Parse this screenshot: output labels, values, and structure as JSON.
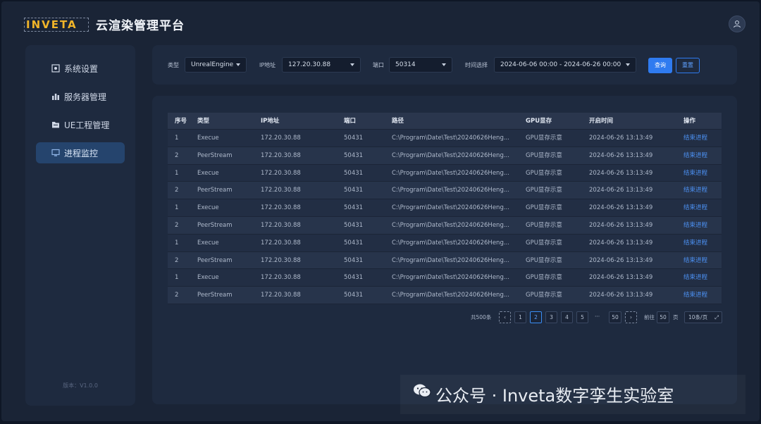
{
  "header": {
    "logo_text": "INVETA",
    "title": "云渲染管理平台"
  },
  "sidebar": {
    "items": [
      {
        "label": "系统设置",
        "icon": "gear-icon"
      },
      {
        "label": "服务器管理",
        "icon": "server-icon"
      },
      {
        "label": "UE工程管理",
        "icon": "folder-icon"
      },
      {
        "label": "进程监控",
        "icon": "monitor-icon",
        "active": true
      }
    ],
    "version": "版本：V1.0.0"
  },
  "filters": {
    "type_label": "类型",
    "type_value": "UnrealEngine",
    "ip_label": "IP地址",
    "ip_value": "127.20.30.88",
    "port_label": "端口",
    "port_value": "50314",
    "time_label": "时间选择",
    "time_value": "2024-06-06 00:00 - 2024-06-26 00:00",
    "query_label": "查询",
    "reset_label": "重置"
  },
  "table": {
    "columns": [
      "序号",
      "类型",
      "IP地址",
      "端口",
      "路径",
      "GPU显存",
      "开启时间",
      "操作"
    ],
    "rows": [
      [
        "1",
        "Execue",
        "172.20.30.88",
        "50431",
        "C:\\Program\\Date\\Test\\20240626Heng...",
        "GPU显存示意",
        "2024-06-26 13:13:49",
        "结束进程"
      ],
      [
        "2",
        "PeerStream",
        "172.20.30.88",
        "50431",
        "C:\\Program\\Date\\Test\\20240626Heng...",
        "GPU显存示意",
        "2024-06-26 13:13:49",
        "结束进程"
      ],
      [
        "1",
        "Execue",
        "172.20.30.88",
        "50431",
        "C:\\Program\\Date\\Test\\20240626Heng...",
        "GPU显存示意",
        "2024-06-26 13:13:49",
        "结束进程"
      ],
      [
        "2",
        "PeerStream",
        "172.20.30.88",
        "50431",
        "C:\\Program\\Date\\Test\\20240626Heng...",
        "GPU显存示意",
        "2024-06-26 13:13:49",
        "结束进程"
      ],
      [
        "1",
        "Execue",
        "172.20.30.88",
        "50431",
        "C:\\Program\\Date\\Test\\20240626Heng...",
        "GPU显存示意",
        "2024-06-26 13:13:49",
        "结束进程"
      ],
      [
        "2",
        "PeerStream",
        "172.20.30.88",
        "50431",
        "C:\\Program\\Date\\Test\\20240626Heng...",
        "GPU显存示意",
        "2024-06-26 13:13:49",
        "结束进程"
      ],
      [
        "1",
        "Execue",
        "172.20.30.88",
        "50431",
        "C:\\Program\\Date\\Test\\20240626Heng...",
        "GPU显存示意",
        "2024-06-26 13:13:49",
        "结束进程"
      ],
      [
        "2",
        "PeerStream",
        "172.20.30.88",
        "50431",
        "C:\\Program\\Date\\Test\\20240626Heng...",
        "GPU显存示意",
        "2024-06-26 13:13:49",
        "结束进程"
      ],
      [
        "1",
        "Execue",
        "172.20.30.88",
        "50431",
        "C:\\Program\\Date\\Test\\20240626Heng...",
        "GPU显存示意",
        "2024-06-26 13:13:49",
        "结束进程"
      ],
      [
        "2",
        "PeerStream",
        "172.20.30.88",
        "50431",
        "C:\\Program\\Date\\Test\\20240626Heng...",
        "GPU显存示意",
        "2024-06-26 13:13:49",
        "结束进程"
      ]
    ]
  },
  "pagination": {
    "total": "共500条",
    "pages": [
      "1",
      "2",
      "3",
      "4",
      "5"
    ],
    "current": "2",
    "ellipsis": "···",
    "last": "50",
    "goto_label": "前往",
    "goto_value": "50",
    "page_unit": "页",
    "page_size": "10条/页"
  },
  "watermark": {
    "text": "公众号 · Inveta数字孪生实验室"
  }
}
